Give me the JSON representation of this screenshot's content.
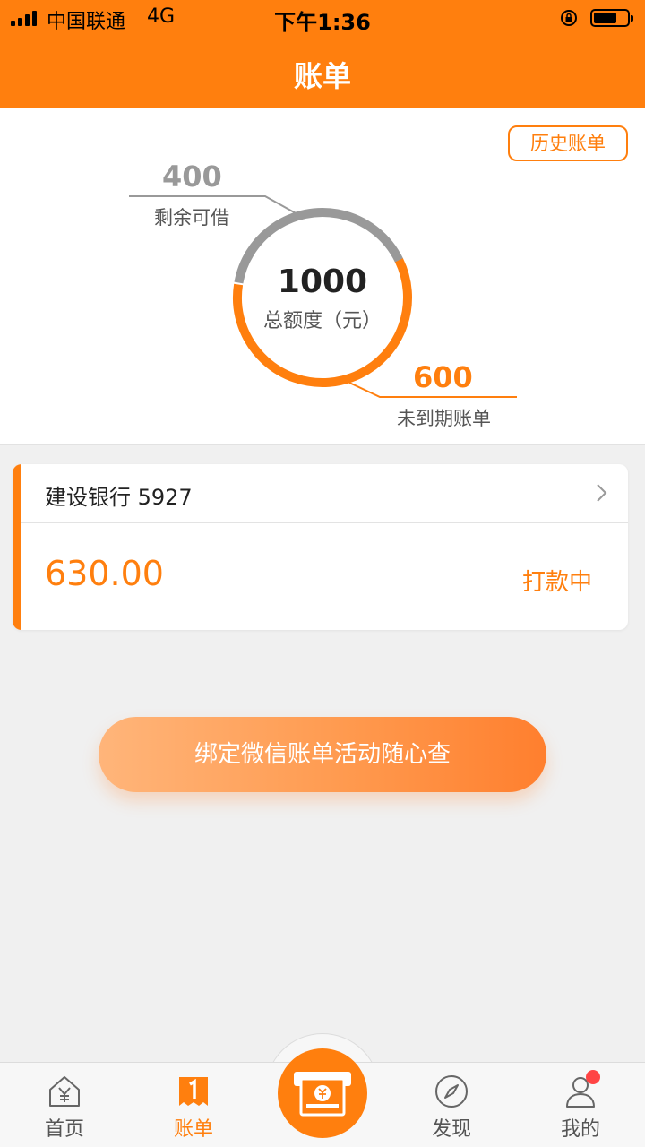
{
  "status_bar": {
    "carrier": "中国联通",
    "network": "4G",
    "time": "下午1:36"
  },
  "nav": {
    "title": "账单"
  },
  "summary": {
    "history_button": "历史账单",
    "total_amount": "1000",
    "total_label": "总额度（元）",
    "remaining_amount": "400",
    "remaining_label": "剩余可借",
    "unpaid_amount": "600",
    "unpaid_label": "未到期账单"
  },
  "bill_card": {
    "bank": "建设银行 5927",
    "amount": "630.00",
    "status": "打款中"
  },
  "bind_button": "绑定微信账单活动随心查",
  "tabbar": {
    "items": [
      {
        "label": "首页",
        "icon": "home-yen-icon"
      },
      {
        "label": "账单",
        "icon": "bill-icon",
        "active": true
      },
      {
        "label": "",
        "icon": "cash-icon"
      },
      {
        "label": "发现",
        "icon": "compass-icon"
      },
      {
        "label": "我的",
        "icon": "user-icon"
      }
    ]
  },
  "colors": {
    "accent": "#ff7f0e",
    "gray": "#999999",
    "badge": "#ff4444"
  }
}
